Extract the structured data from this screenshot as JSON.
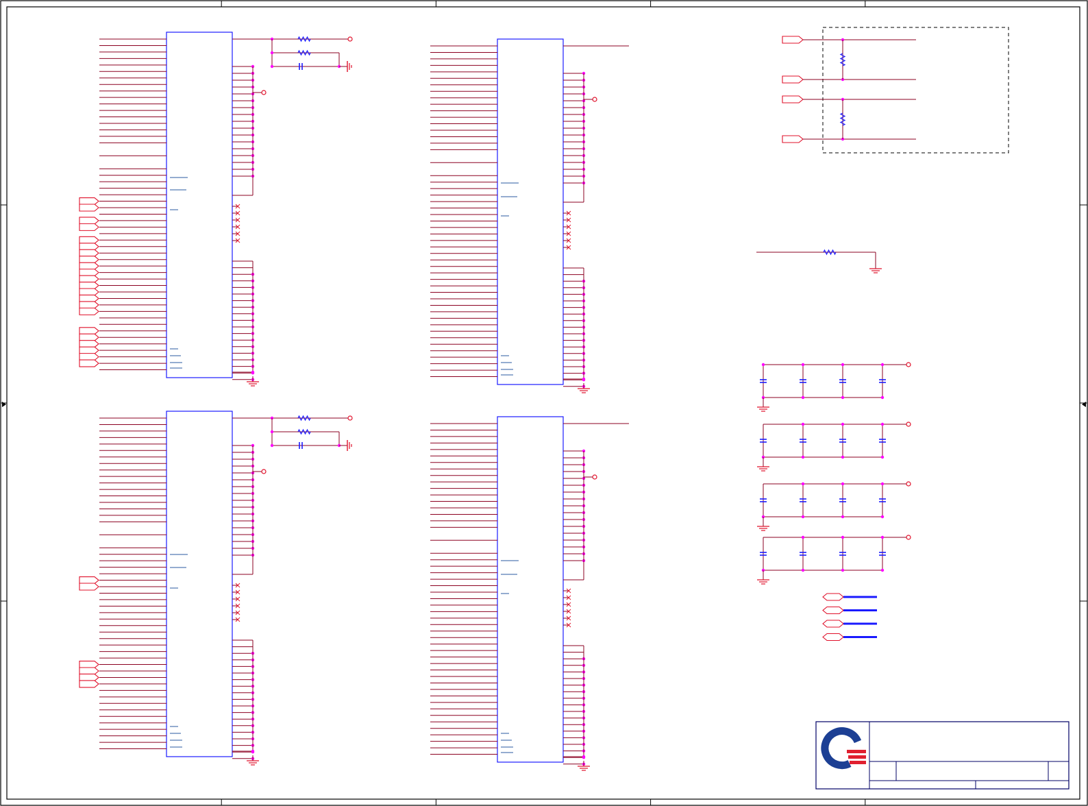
{
  "sheet": {
    "border_color": "#000000",
    "wire_color": "#8b0020",
    "net_color": "#e0102a",
    "component_color": "#1a1aff",
    "junction_color": "#ff00ff",
    "label_color": "#2a5aa0",
    "title_block_color": "#000066",
    "zone_columns": 5,
    "zone_rows": 4
  },
  "logo": {
    "name": "company-logo",
    "primary_color": "#1c3f94",
    "accent_color": "#e02030"
  },
  "title_block": {
    "title": "",
    "document_number": "",
    "revision": "",
    "sheet": "",
    "date": ""
  },
  "blocks": {
    "ic_top_left": {
      "left_pins": 52,
      "right_upper_pins": 17,
      "right_nc_pins": 6,
      "right_lower_pins": 19
    },
    "ic_bottom_left": {
      "left_pins": 52,
      "right_upper_pins": 17,
      "right_nc_pins": 6,
      "right_lower_pins": 19
    },
    "ic_top_right": {
      "left_pins": 52,
      "right_upper_pins": 17,
      "right_nc_pins": 6,
      "right_lower_pins": 19
    },
    "ic_bottom_right": {
      "left_pins": 52,
      "right_upper_pins": 17,
      "right_nc_pins": 6,
      "right_lower_pins": 19
    },
    "termination_group": {
      "resistors": 2,
      "ports": 4
    },
    "decoupling_rows": 4,
    "caps_per_row": 4,
    "legend_ports": 4
  }
}
